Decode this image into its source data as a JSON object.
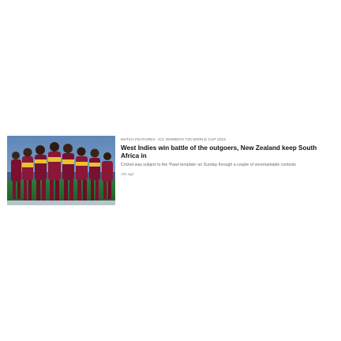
{
  "article": {
    "category_primary": "MATCH FEATURES",
    "category_secondary": "ICC WOMEN'S T20 WORLD CUP 2023",
    "separator": "·",
    "headline": "West Indies win battle of the outgoers, New Zealand keep South Africa in",
    "summary": "Cricket was subject to the 'Paarl template' on Sunday through a couple of unremarkable contests",
    "timestamp": "15h ago",
    "image_subject": "west-indies-women-players-huddle-photo"
  },
  "colors": {
    "headline": "#111111",
    "summary": "#6a6a6a",
    "kicker": "#6b6b6b",
    "jersey_maroon": "#7a1030",
    "jersey_yellow": "#e8c230",
    "sky": "#6f96c4"
  }
}
